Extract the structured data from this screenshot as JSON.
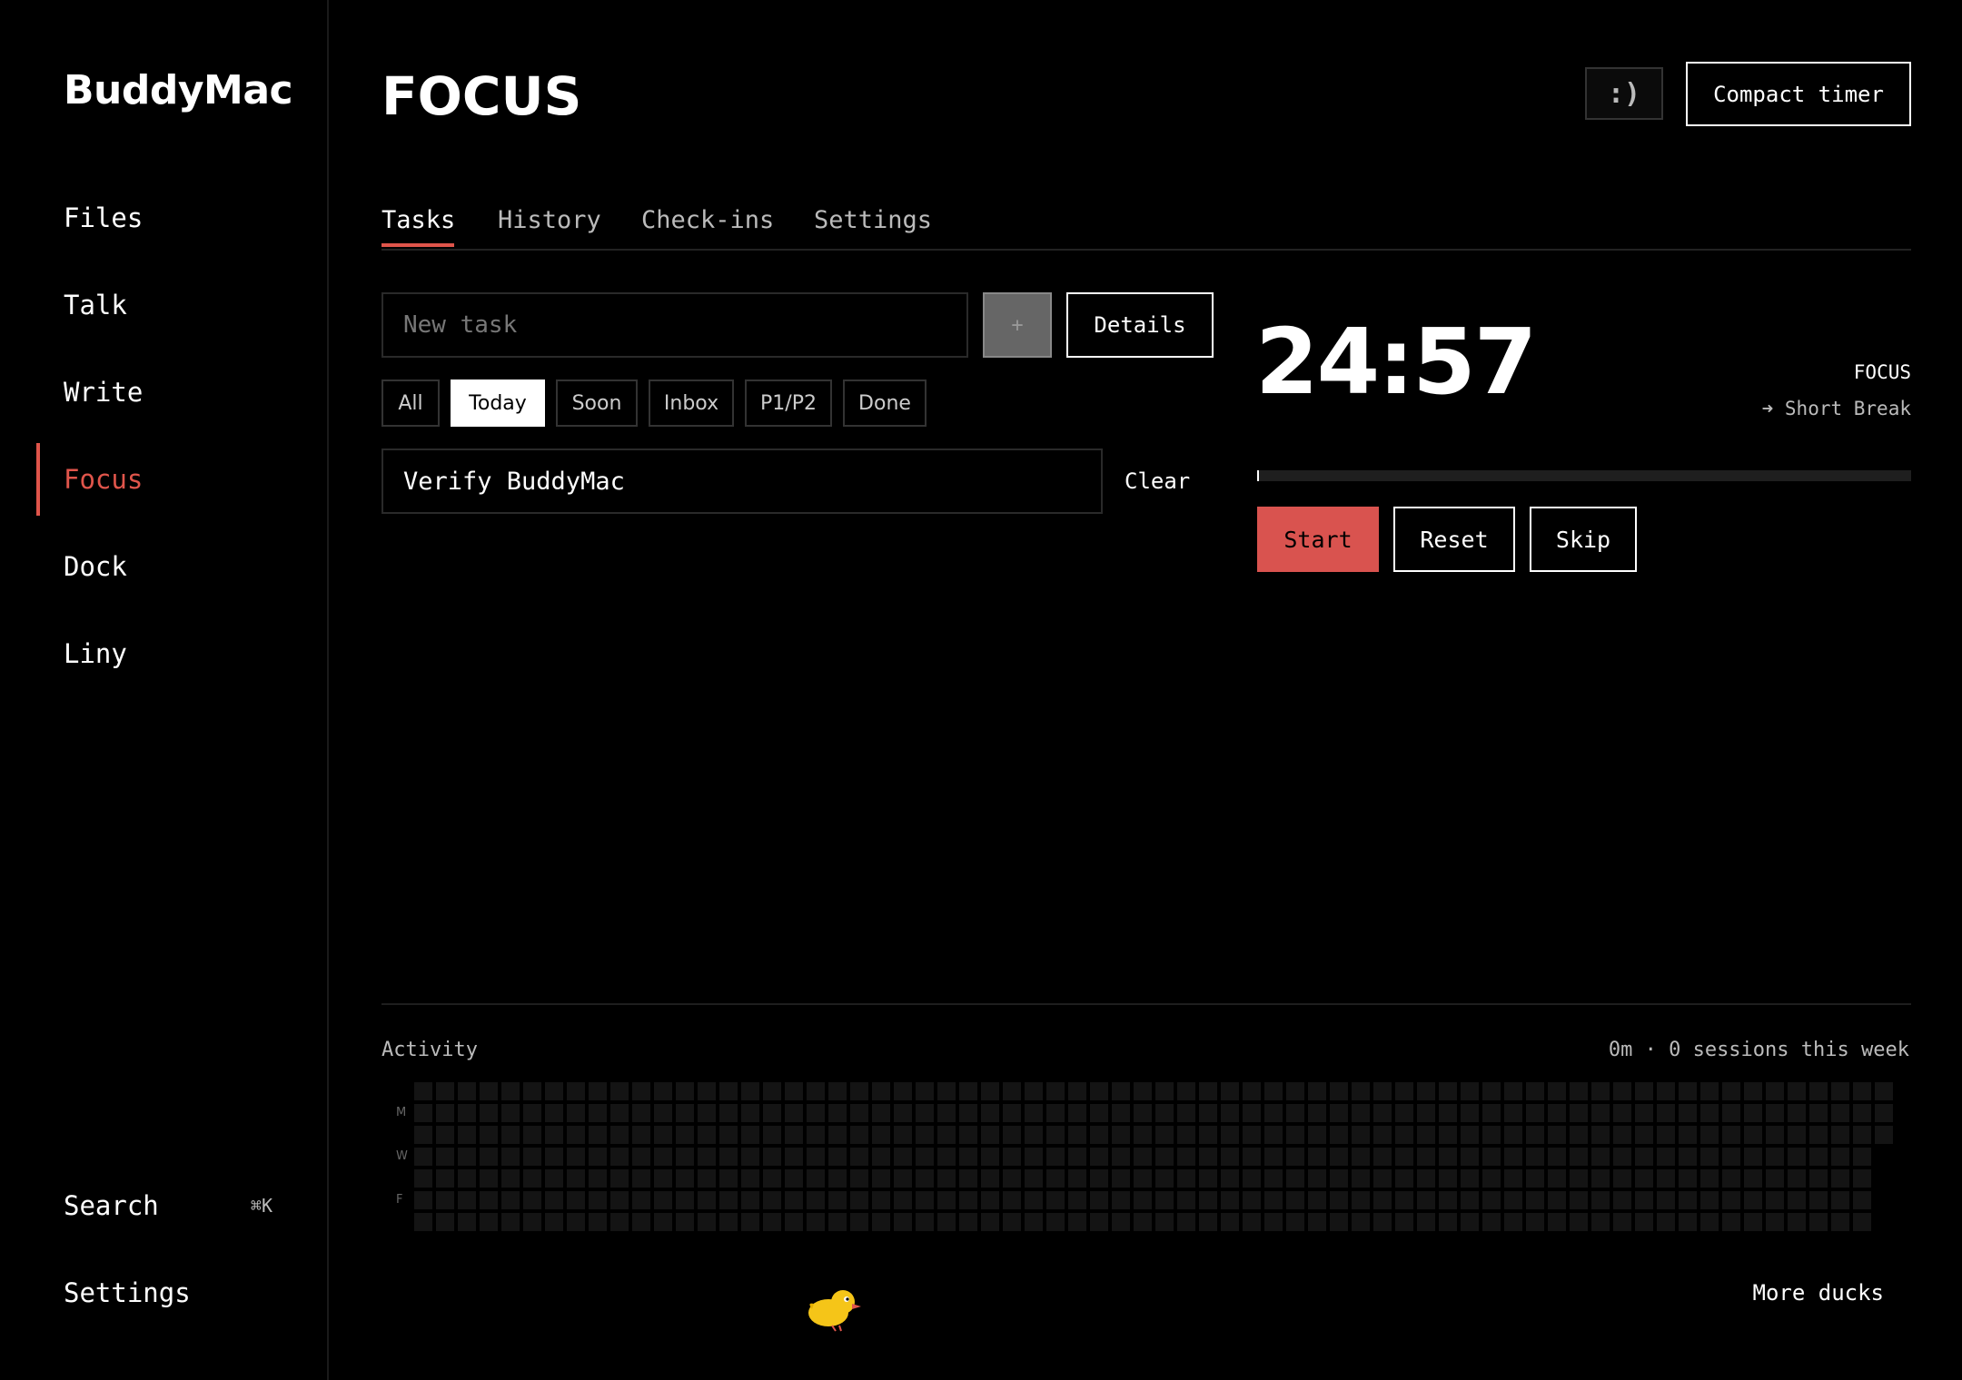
{
  "app": {
    "title": "BuddyMac"
  },
  "sidebar": {
    "items": [
      {
        "label": "Files"
      },
      {
        "label": "Talk"
      },
      {
        "label": "Write"
      },
      {
        "label": "Focus"
      },
      {
        "label": "Dock"
      },
      {
        "label": "Liny"
      }
    ],
    "active": "Focus",
    "search_label": "Search",
    "search_shortcut": "⌘K",
    "settings_label": "Settings"
  },
  "header": {
    "title": "FOCUS",
    "smile_label": ":)",
    "compact_timer_label": "Compact timer"
  },
  "tabs": [
    {
      "label": "Tasks"
    },
    {
      "label": "History"
    },
    {
      "label": "Check-ins"
    },
    {
      "label": "Settings"
    }
  ],
  "active_tab": "Tasks",
  "tasks": {
    "new_task_placeholder": "New task",
    "add_label": "+",
    "details_label": "Details",
    "filters": [
      "All",
      "Today",
      "Soon",
      "Inbox",
      "P1/P2",
      "Done"
    ],
    "active_filter": "Today",
    "items": [
      {
        "title": "Verify BuddyMac"
      }
    ],
    "clear_label": "Clear"
  },
  "timer": {
    "time": "24:57",
    "mode": "FOCUS",
    "next": "➜ Short Break",
    "progress": 0.002,
    "start_label": "Start",
    "reset_label": "Reset",
    "skip_label": "Skip"
  },
  "activity": {
    "label": "Activity",
    "summary": "0m · 0 sessions this week",
    "day_labels": [
      "M",
      "W",
      "F"
    ]
  },
  "footer": {
    "more_ducks_label": "More ducks",
    "duck_icon": "duck-icon"
  },
  "colors": {
    "accent": "#e0554b",
    "background": "#000000"
  }
}
